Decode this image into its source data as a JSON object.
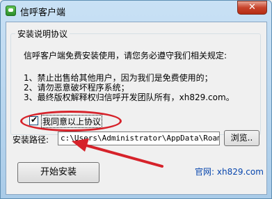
{
  "window": {
    "title": "信呼客户端",
    "close_glyph": "✕"
  },
  "agreement": {
    "group_title": "安装说明协议",
    "intro": "信呼客户端免费安装使用，请您务必遵守我们相关规定:",
    "rules": [
      "1、禁止出售给其他用户，因为我们是免费使用的；",
      "2、请勿恶意破坏程序系统；",
      "3、最终版权解释权归信呼开发团队所有，xh829.com。"
    ],
    "checkbox_label": "我同意以上协议",
    "checked": true,
    "check_glyph": "✔"
  },
  "install_path": {
    "label": "安装路径:",
    "value": "c:\\Users\\Administrator\\AppData\\Roaming",
    "browse_label": "浏览.."
  },
  "actions": {
    "install_label": "开始安装"
  },
  "footer": {
    "site_text": "官网: xh829.com"
  },
  "annotations": {
    "highlight_color": "#d6222a"
  }
}
